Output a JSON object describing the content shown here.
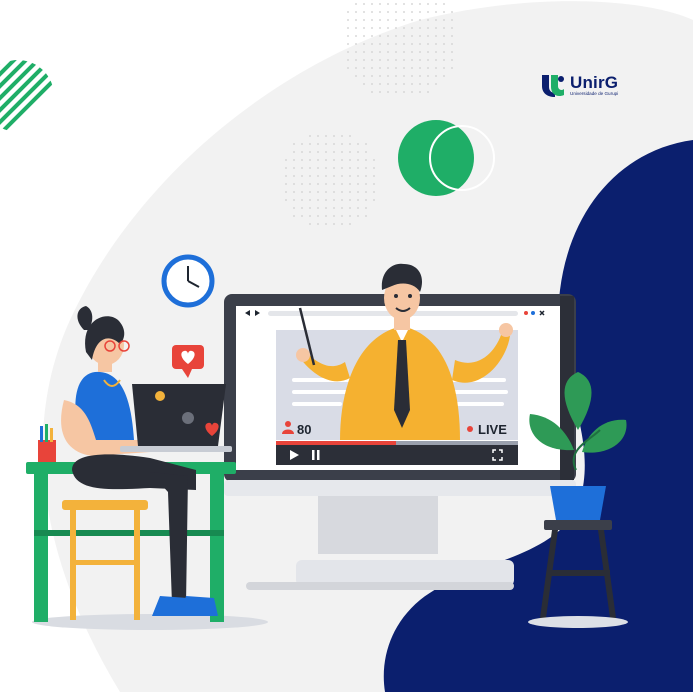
{
  "brand": {
    "name": "UnirG",
    "tagline": "Universidade de Gurupi",
    "colors": {
      "navy": "#0b1f6e",
      "green": "#1fae67"
    }
  },
  "video_player": {
    "viewer_count": "80",
    "live_label": "LIVE",
    "icons": [
      "back-icon",
      "forward-icon",
      "play-icon",
      "pause-icon",
      "fullscreen-icon",
      "close-icon",
      "user-icon",
      "heart-icon"
    ]
  },
  "colors": {
    "presenter_shirt": "#f5b130",
    "monitor": "#3b3f4a",
    "plant": "#2e9a56",
    "desk": "#1fae67",
    "chair": "#f3b23b"
  }
}
